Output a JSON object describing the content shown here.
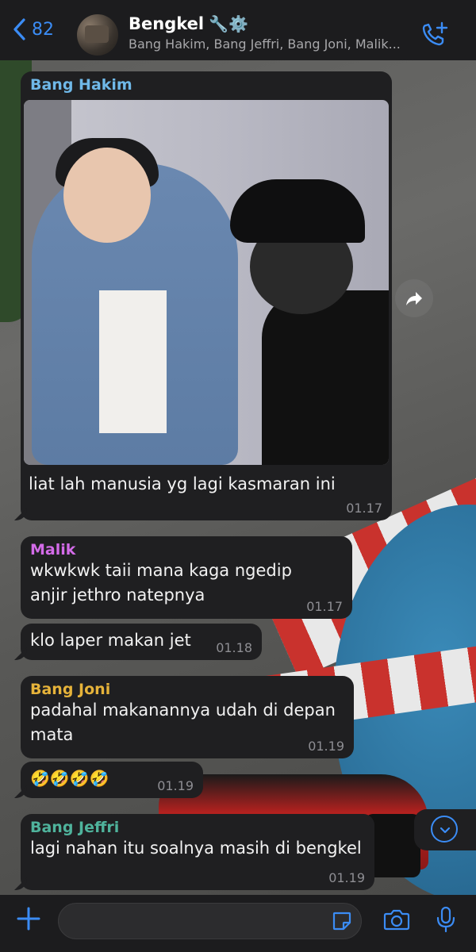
{
  "header": {
    "back_count": "82",
    "title": "Bengkel",
    "title_emojis": "🔧⚙️",
    "subtitle": "Bang Hakim, Bang Jeffri, Bang Joni, Malik..."
  },
  "messages": [
    {
      "sender": "Bang Hakim",
      "sender_color": "#6fb8e8",
      "text": "liat lah manusia yg lagi kasmaran ini",
      "time": "01.17",
      "has_photo": true
    },
    {
      "sender": "Malik",
      "sender_color": "#d36be8",
      "text": "wkwkwk taii mana kaga ngedip anjir jethro natepnya",
      "time": "01.17"
    },
    {
      "sender": "",
      "text": "klo laper makan jet",
      "time": "01.18"
    },
    {
      "sender": "Bang Joni",
      "sender_color": "#e6b33a",
      "text": "padahal makanannya udah di depan mata",
      "time": "01.19"
    },
    {
      "sender": "",
      "text": "🤣🤣🤣🤣",
      "time": "01.19"
    },
    {
      "sender": "Bang Jeffri",
      "sender_color": "#4fb39c",
      "text": "lagi nahan itu soalnya masih di bengkel",
      "time": "01.19"
    }
  ],
  "composer": {
    "value": ""
  },
  "icons": {
    "back": "chevron-left-icon",
    "call": "phone-add-icon",
    "forward": "share-forward-icon",
    "scroll": "chevron-down-icon",
    "attach": "plus-icon",
    "sticker": "sticker-icon",
    "camera": "camera-icon",
    "mic": "microphone-icon"
  },
  "colors": {
    "accent": "#3b8cf5",
    "bubble": "#1f1f21",
    "bar": "#1c1c1e"
  }
}
